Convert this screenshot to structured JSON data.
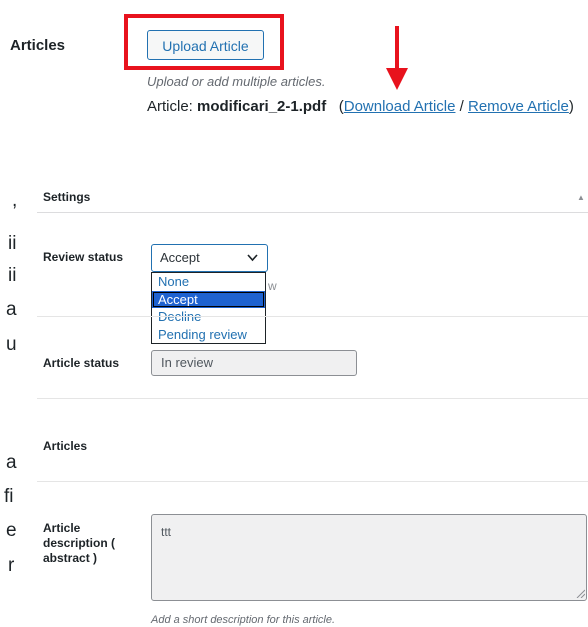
{
  "articles_section": {
    "label": "Articles",
    "upload_button": "Upload Article",
    "hint": "Upload or add multiple articles.",
    "article_prefix": "Article: ",
    "file_name": "modificari_2-1.pdf",
    "open_paren": "(",
    "download_link": "Download Article",
    "separator": " / ",
    "remove_link": "Remove Article",
    "close_paren": ")",
    "annotation_color": "#e8121d"
  },
  "left_crop_chars": [
    ",",
    "ii",
    "ii",
    "a",
    "u",
    "a",
    "fi",
    "e",
    "r"
  ],
  "settings": {
    "title": "Settings",
    "collapse_icon": "triangle-up-icon",
    "review_status": {
      "label": "Review status",
      "selected": "Accept",
      "options": [
        "None",
        "Accept",
        "Decline",
        "Pending review"
      ],
      "partial_text": "w"
    },
    "article_status": {
      "label": "Article status",
      "value": "In review"
    },
    "articles_label": "Articles",
    "article_description": {
      "label_lines": [
        "Article",
        "description (",
        "abstract )"
      ],
      "value": "ttt",
      "hint": "Add a short description for this article."
    }
  }
}
